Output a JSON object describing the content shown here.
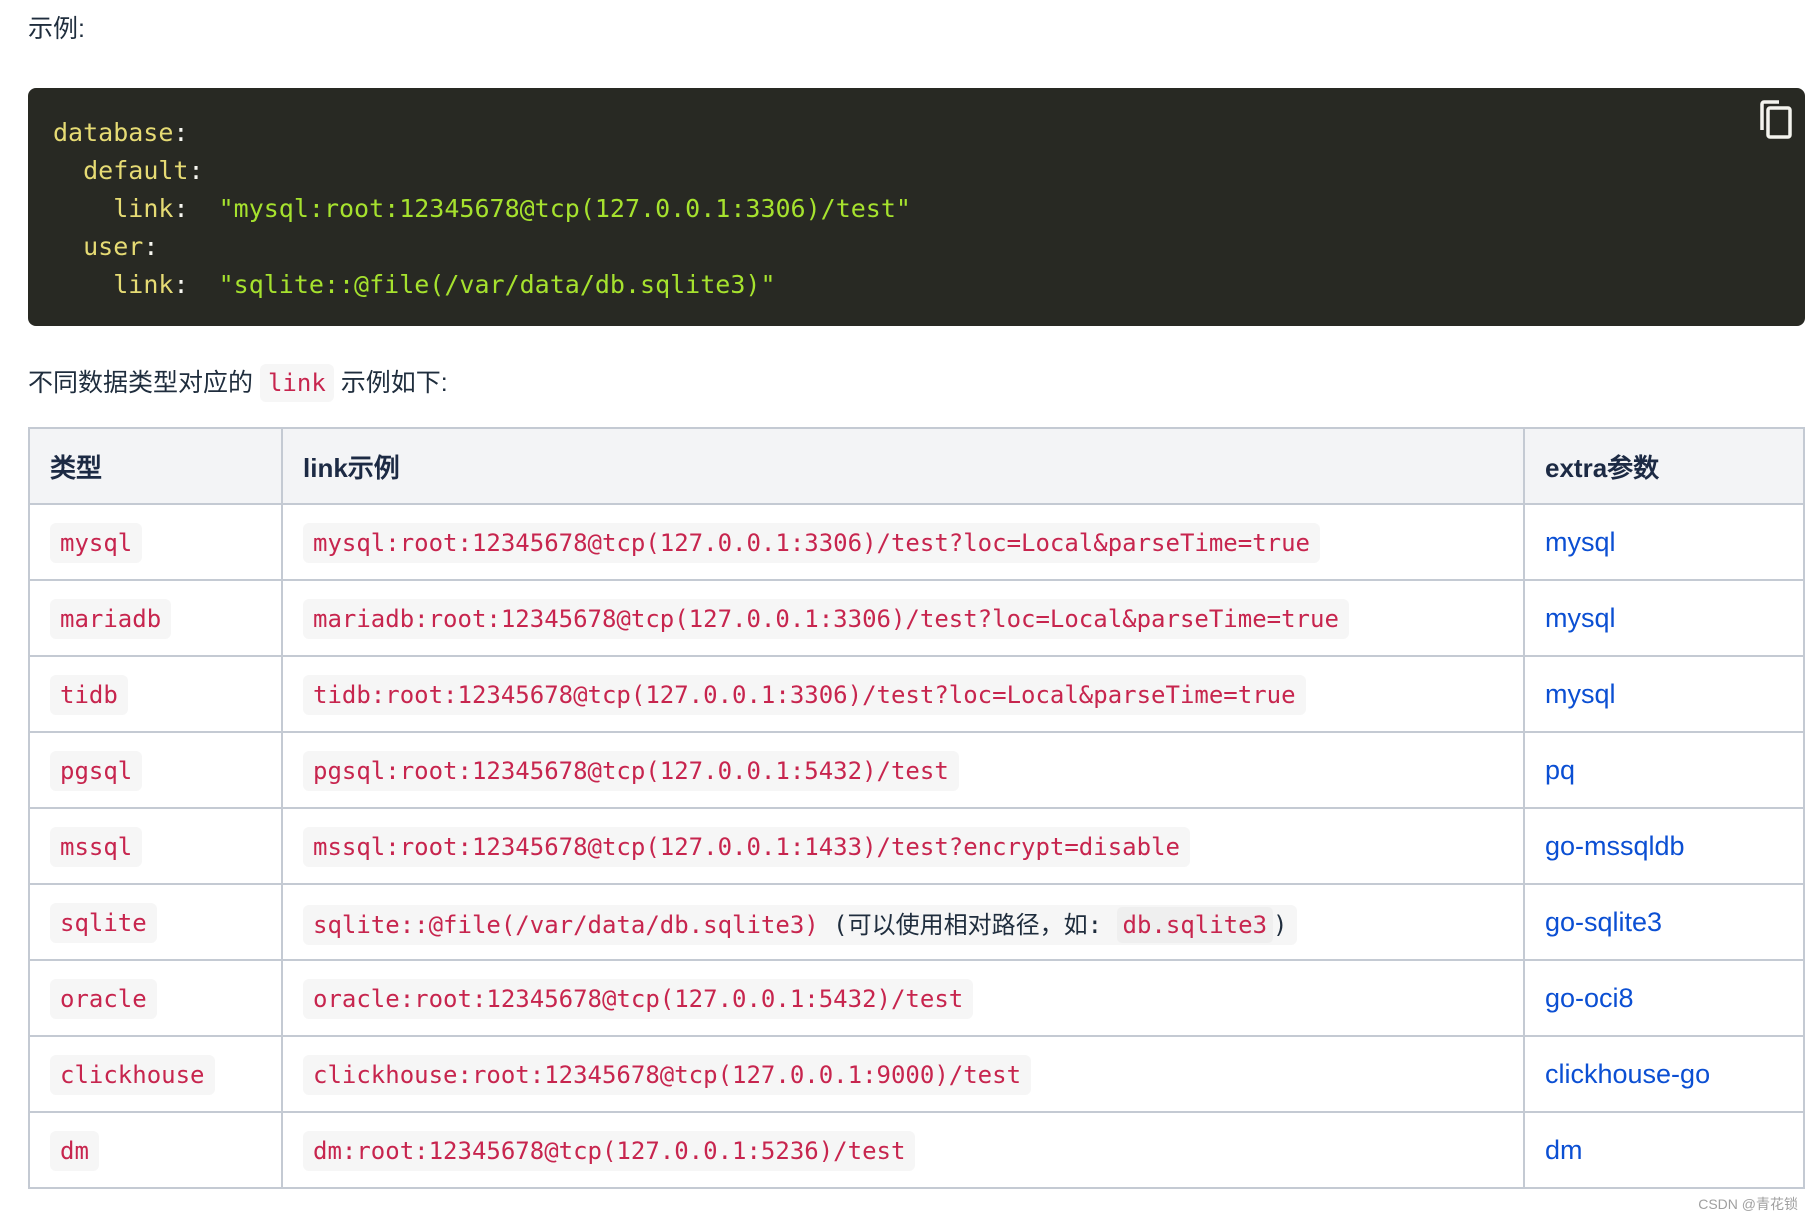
{
  "intro": {
    "text": "示例:"
  },
  "code_block": {
    "lines": [
      {
        "indent": "",
        "key": "database",
        "colon": ":",
        "value": ""
      },
      {
        "indent": "  ",
        "key": "default",
        "colon": ":",
        "value": ""
      },
      {
        "indent": "    ",
        "key": "link",
        "colon": ":  ",
        "value": "\"mysql:root:12345678@tcp(127.0.0.1:3306)/test\""
      },
      {
        "indent": "  ",
        "key": "user",
        "colon": ":",
        "value": ""
      },
      {
        "indent": "    ",
        "key": "link",
        "colon": ":  ",
        "value": "\"sqlite::@file(/var/data/db.sqlite3)\""
      }
    ],
    "copy_icon": "copy-icon"
  },
  "paragraph": {
    "before": "不同数据类型对应的",
    "code": "link",
    "after": "示例如下:"
  },
  "table": {
    "headers": [
      "类型",
      "link示例",
      "extra参数"
    ],
    "rows": [
      {
        "type": "mysql",
        "link": "mysql:root:12345678@tcp(127.0.0.1:3306)/test?loc=Local&parseTime=true",
        "note": "",
        "note_code": "",
        "note_end": "",
        "extra": "mysql"
      },
      {
        "type": "mariadb",
        "link": "mariadb:root:12345678@tcp(127.0.0.1:3306)/test?loc=Local&parseTime=true",
        "note": "",
        "note_code": "",
        "note_end": "",
        "extra": "mysql"
      },
      {
        "type": "tidb",
        "link": "tidb:root:12345678@tcp(127.0.0.1:3306)/test?loc=Local&parseTime=true",
        "note": "",
        "note_code": "",
        "note_end": "",
        "extra": "mysql"
      },
      {
        "type": "pgsql",
        "link": "pgsql:root:12345678@tcp(127.0.0.1:5432)/test",
        "note": "",
        "note_code": "",
        "note_end": "",
        "extra": "pq"
      },
      {
        "type": "mssql",
        "link": "mssql:root:12345678@tcp(127.0.0.1:1433)/test?encrypt=disable",
        "note": "",
        "note_code": "",
        "note_end": "",
        "extra": "go-mssqldb"
      },
      {
        "type": "sqlite",
        "link": "sqlite::@file(/var/data/db.sqlite3)",
        "note": " (可以使用相对路径，如: ",
        "note_code": "db.sqlite3",
        "note_end": ")",
        "extra": "go-sqlite3"
      },
      {
        "type": "oracle",
        "link": "oracle:root:12345678@tcp(127.0.0.1:5432)/test",
        "note": "",
        "note_code": "",
        "note_end": "",
        "extra": "go-oci8"
      },
      {
        "type": "clickhouse",
        "link": "clickhouse:root:12345678@tcp(127.0.0.1:9000)/test",
        "note": "",
        "note_code": "",
        "note_end": "",
        "extra": "clickhouse-go"
      },
      {
        "type": "dm",
        "link": "dm:root:12345678@tcp(127.0.0.1:5236)/test",
        "note": "",
        "note_code": "",
        "note_end": "",
        "extra": "dm"
      }
    ]
  },
  "watermark": "CSDN @青花锁",
  "colors": {
    "code_bg": "#282923",
    "code_key": "#e6db74",
    "code_string": "#a6e22e",
    "inline_code": "#c7254e",
    "link": "#0b4fd3",
    "table_border": "#c4cad3",
    "header_bg": "#f3f4f6"
  }
}
